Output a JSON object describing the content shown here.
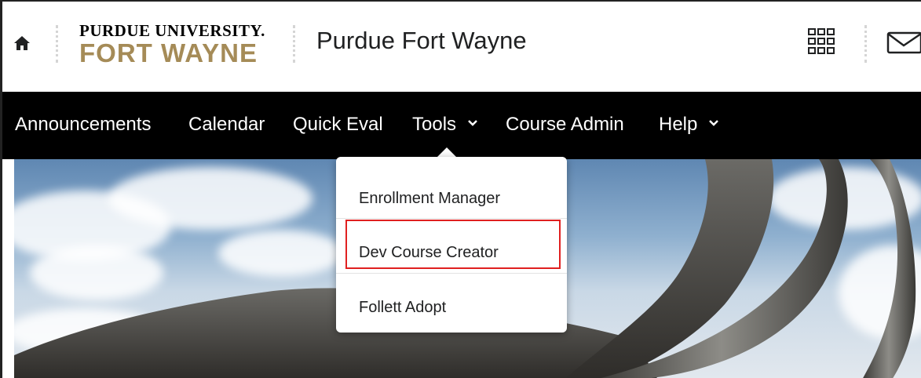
{
  "header": {
    "logo_top": "PURDUE UNIVERSITY.",
    "logo_bottom": "FORT WAYNE",
    "site_title": "Purdue Fort Wayne"
  },
  "nav": {
    "items": [
      {
        "label": "Announcements"
      },
      {
        "label": "Calendar"
      },
      {
        "label": "Quick Eval"
      },
      {
        "label": "Tools"
      },
      {
        "label": "Course Admin"
      },
      {
        "label": "Help"
      }
    ]
  },
  "tools_menu": {
    "items": [
      {
        "label": "Enrollment Manager"
      },
      {
        "label": "Dev Course Creator"
      },
      {
        "label": "Follett Adopt"
      }
    ]
  },
  "icons": {
    "home": "home-icon",
    "grid": "app-grid-icon",
    "mail": "mail-icon",
    "chevron": "chevron-down-icon"
  },
  "colors": {
    "logo_gold": "#a58b57",
    "navbar": "#000000",
    "highlight": "#e02020"
  }
}
